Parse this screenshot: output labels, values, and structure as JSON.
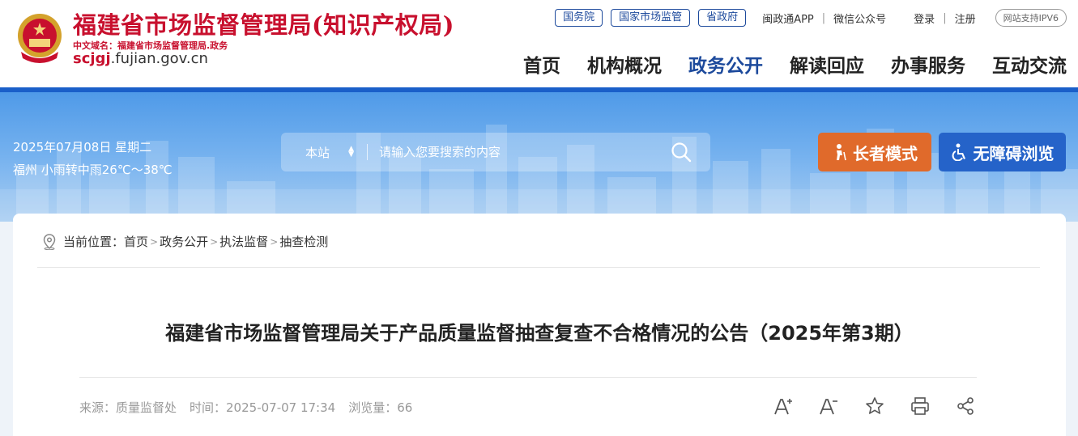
{
  "header": {
    "site_title": "福建省市场监督管理局(知识产权局)",
    "domain_prefix": "中文域名：",
    "domain_cn": "福建省市场监督管理局.政务",
    "domain_url_highlight": "scjgj",
    "domain_url_rest": ".fujian.gov.cn"
  },
  "top_links": {
    "pills": [
      "国务院",
      "国家市场监管",
      "省政府"
    ],
    "app": "闽政通APP",
    "wechat": "微信公众号",
    "login": "登录",
    "register": "注册",
    "ipv6": "网站支持IPV6"
  },
  "nav": {
    "items": [
      "首页",
      "机构概况",
      "政务公开",
      "解读回应",
      "办事服务",
      "互动交流"
    ],
    "active": "政务公开"
  },
  "weather": {
    "date": "2025年07月08日 星期二",
    "forecast": "福州 小雨转中雨26℃～38℃"
  },
  "search": {
    "scope": "本站",
    "placeholder": "请输入您要搜索的内容"
  },
  "buttons": {
    "elder": "长者模式",
    "accessibility": "无障碍浏览"
  },
  "breadcrumb": {
    "prefix": "当前位置：",
    "items": [
      "首页",
      "政务公开",
      "执法监督",
      "抽查检测"
    ]
  },
  "article": {
    "title": "福建省市场监督管理局关于产品质量监督抽查复查不合格情况的公告（2025年第3期）",
    "source": "来源：质量监督处",
    "time": "时间：2025-07-07 17:34",
    "views": "浏览量：66"
  },
  "colors": {
    "brand_red": "#c8102e",
    "nav_blue": "#1d4a9c",
    "elder_orange": "#e06a2b",
    "access_blue": "#2563c9"
  }
}
